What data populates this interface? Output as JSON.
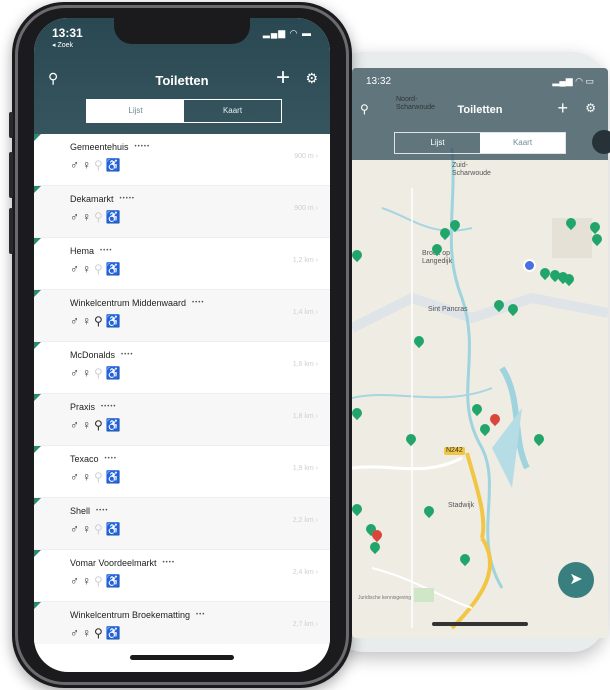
{
  "front": {
    "status": {
      "time": "13:31",
      "back_label": "◂ Zoek"
    },
    "header": {
      "title": "Toiletten"
    },
    "segmented": {
      "list_label": "Lijst",
      "map_label": "Kaart"
    },
    "rows": [
      {
        "name": "Gemeentehuis",
        "stars": "•••••",
        "distance": "900 m",
        "icons": [
          "on",
          "on",
          "off",
          "on"
        ]
      },
      {
        "name": "Dekamarkt",
        "stars": "•••••",
        "distance": "900 m",
        "icons": [
          "on",
          "on",
          "off",
          "off"
        ]
      },
      {
        "name": "Hema",
        "stars": "••••",
        "distance": "1,2 km",
        "icons": [
          "on",
          "on",
          "off",
          "off"
        ]
      },
      {
        "name": "Winkelcentrum Middenwaard",
        "stars": "••••",
        "distance": "1,4 km",
        "icons": [
          "on",
          "on",
          "on",
          "on"
        ]
      },
      {
        "name": "McDonalds",
        "stars": "••••",
        "distance": "1,6 km",
        "icons": [
          "on",
          "on",
          "off",
          "off"
        ]
      },
      {
        "name": "Praxis",
        "stars": "•••••",
        "distance": "1,8 km",
        "icons": [
          "on",
          "on",
          "on",
          "on"
        ]
      },
      {
        "name": "Texaco",
        "stars": "••••",
        "distance": "1,9 km",
        "icons": [
          "on",
          "on",
          "off",
          "off"
        ]
      },
      {
        "name": "Shell",
        "stars": "••••",
        "distance": "2,2 km",
        "icons": [
          "on",
          "on",
          "off",
          "off"
        ]
      },
      {
        "name": "Vomar Voordeelmarkt",
        "stars": "••••",
        "distance": "2,4 km",
        "icons": [
          "on",
          "on",
          "off",
          "on"
        ]
      },
      {
        "name": "Winkelcentrum Broekematting",
        "stars": "•••",
        "distance": "2,7 km",
        "icons": [
          "on",
          "on",
          "on",
          "on"
        ]
      }
    ]
  },
  "back": {
    "status": {
      "time": "13:32"
    },
    "header": {
      "title": "Toiletten"
    },
    "segmented": {
      "list_label": "Lijst",
      "map_label": "Kaart"
    },
    "map_labels": {
      "noord_schardam": "Noord-\nScharwoude",
      "zuid_scharwoude": "Zuid-\nScharwoude",
      "broek": "Broek op\nLangedijk",
      "sint_pancras": "Sint Pancras",
      "stadwijk": "Stadwijk",
      "road": "N242",
      "attribution": "Juridische kennisgeving"
    }
  },
  "colors": {
    "header": "#37555e",
    "pin_green": "#22a56b",
    "pin_red": "#d9463b",
    "accent": "#2a8a6f"
  }
}
